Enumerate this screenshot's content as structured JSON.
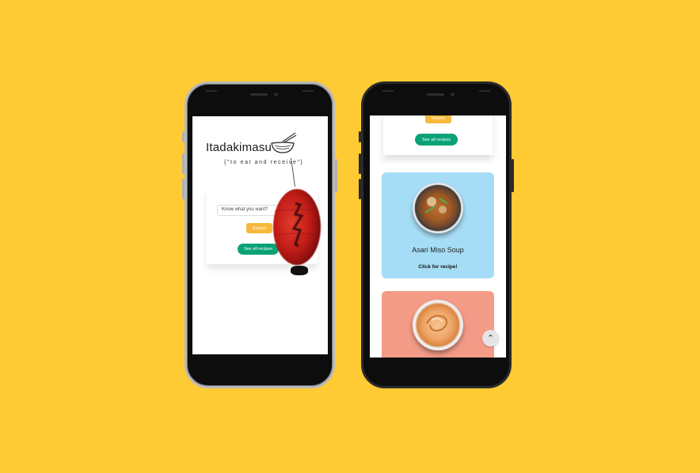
{
  "colors": {
    "background": "#FECB34",
    "search_button": "#F7B93C",
    "see_all_button": "#0AA276",
    "card_blue": "#A6DDF6",
    "card_salmon": "#F39B87"
  },
  "home_screen": {
    "title": "Itadakimasu",
    "tagline": "{\"to eat and receive\"}",
    "search": {
      "placeholder": "Know what you want?"
    },
    "search_button": "Search",
    "see_all_button": "See all recipes",
    "icons": [
      "noodle-bowl-icon",
      "lantern-image"
    ]
  },
  "recipes_screen": {
    "search_button": "Search",
    "see_all_button": "See all recipes",
    "recipes": [
      {
        "name": "Asari Miso Soup",
        "cta": "Click for recipe!",
        "image": "miso-soup-bowl"
      },
      {
        "name": "",
        "cta": "",
        "image": "dessert-bowl"
      }
    ],
    "scroll_top_icon": "chevron-up-icon"
  }
}
